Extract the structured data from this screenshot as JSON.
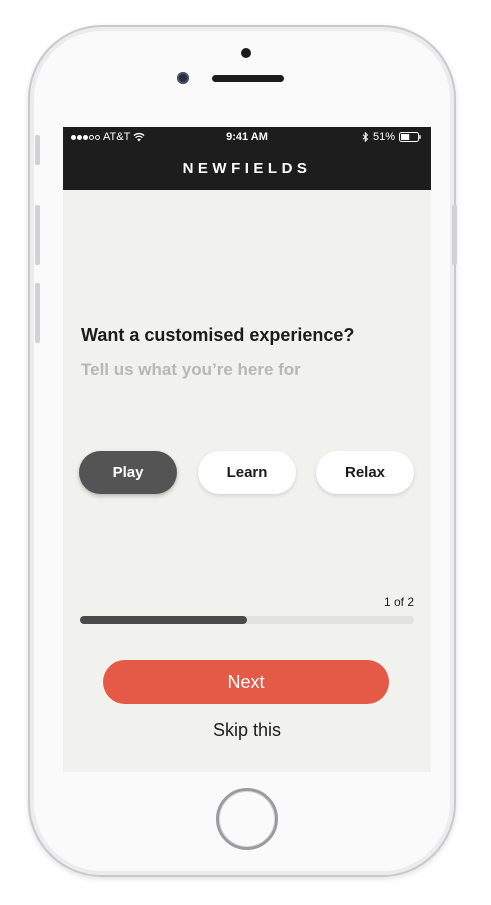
{
  "status_bar": {
    "carrier": "AT&T",
    "time": "9:41 AM",
    "battery_percent": "51%",
    "signal_bars_filled": 3,
    "signal_bars_total": 5,
    "battery_level": 0.51
  },
  "header": {
    "title": "NEWFIELDS"
  },
  "main": {
    "heading": "Want a customised experience?",
    "subheading": "Tell us what you’re here for",
    "options": [
      {
        "label": "Play",
        "selected": true
      },
      {
        "label": "Learn",
        "selected": false
      },
      {
        "label": "Relax",
        "selected": false
      }
    ],
    "progress": {
      "label": "1 of 2",
      "value": 0.5
    },
    "next_label": "Next",
    "skip_label": "Skip this"
  },
  "colors": {
    "accent": "#e45a47",
    "header_bg": "#1d1d1d",
    "selected_chip": "#545454",
    "screen_bg": "#f1f1ee"
  }
}
